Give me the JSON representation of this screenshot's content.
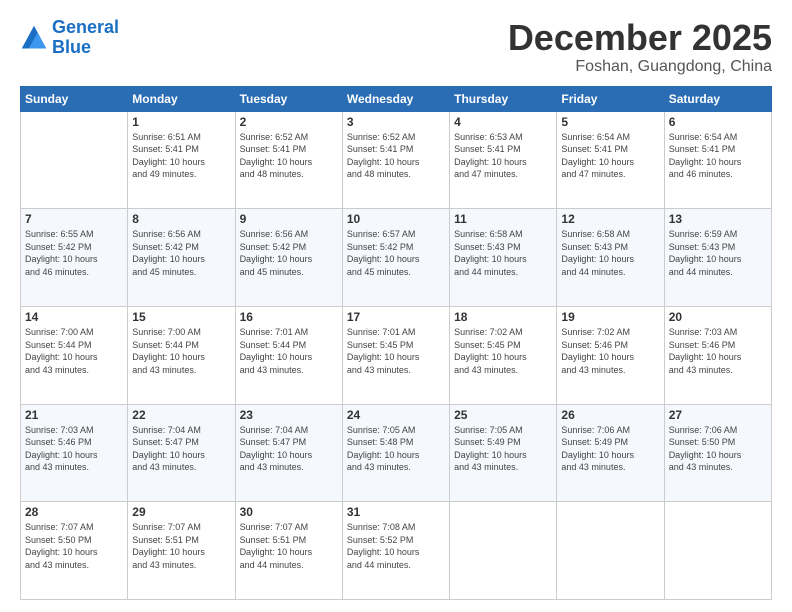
{
  "logo": {
    "line1": "General",
    "line2": "Blue"
  },
  "title": "December 2025",
  "location": "Foshan, Guangdong, China",
  "days_of_week": [
    "Sunday",
    "Monday",
    "Tuesday",
    "Wednesday",
    "Thursday",
    "Friday",
    "Saturday"
  ],
  "weeks": [
    [
      {
        "day": "",
        "info": ""
      },
      {
        "day": "1",
        "info": "Sunrise: 6:51 AM\nSunset: 5:41 PM\nDaylight: 10 hours\nand 49 minutes."
      },
      {
        "day": "2",
        "info": "Sunrise: 6:52 AM\nSunset: 5:41 PM\nDaylight: 10 hours\nand 48 minutes."
      },
      {
        "day": "3",
        "info": "Sunrise: 6:52 AM\nSunset: 5:41 PM\nDaylight: 10 hours\nand 48 minutes."
      },
      {
        "day": "4",
        "info": "Sunrise: 6:53 AM\nSunset: 5:41 PM\nDaylight: 10 hours\nand 47 minutes."
      },
      {
        "day": "5",
        "info": "Sunrise: 6:54 AM\nSunset: 5:41 PM\nDaylight: 10 hours\nand 47 minutes."
      },
      {
        "day": "6",
        "info": "Sunrise: 6:54 AM\nSunset: 5:41 PM\nDaylight: 10 hours\nand 46 minutes."
      }
    ],
    [
      {
        "day": "7",
        "info": "Sunrise: 6:55 AM\nSunset: 5:42 PM\nDaylight: 10 hours\nand 46 minutes."
      },
      {
        "day": "8",
        "info": "Sunrise: 6:56 AM\nSunset: 5:42 PM\nDaylight: 10 hours\nand 45 minutes."
      },
      {
        "day": "9",
        "info": "Sunrise: 6:56 AM\nSunset: 5:42 PM\nDaylight: 10 hours\nand 45 minutes."
      },
      {
        "day": "10",
        "info": "Sunrise: 6:57 AM\nSunset: 5:42 PM\nDaylight: 10 hours\nand 45 minutes."
      },
      {
        "day": "11",
        "info": "Sunrise: 6:58 AM\nSunset: 5:43 PM\nDaylight: 10 hours\nand 44 minutes."
      },
      {
        "day": "12",
        "info": "Sunrise: 6:58 AM\nSunset: 5:43 PM\nDaylight: 10 hours\nand 44 minutes."
      },
      {
        "day": "13",
        "info": "Sunrise: 6:59 AM\nSunset: 5:43 PM\nDaylight: 10 hours\nand 44 minutes."
      }
    ],
    [
      {
        "day": "14",
        "info": "Sunrise: 7:00 AM\nSunset: 5:44 PM\nDaylight: 10 hours\nand 43 minutes."
      },
      {
        "day": "15",
        "info": "Sunrise: 7:00 AM\nSunset: 5:44 PM\nDaylight: 10 hours\nand 43 minutes."
      },
      {
        "day": "16",
        "info": "Sunrise: 7:01 AM\nSunset: 5:44 PM\nDaylight: 10 hours\nand 43 minutes."
      },
      {
        "day": "17",
        "info": "Sunrise: 7:01 AM\nSunset: 5:45 PM\nDaylight: 10 hours\nand 43 minutes."
      },
      {
        "day": "18",
        "info": "Sunrise: 7:02 AM\nSunset: 5:45 PM\nDaylight: 10 hours\nand 43 minutes."
      },
      {
        "day": "19",
        "info": "Sunrise: 7:02 AM\nSunset: 5:46 PM\nDaylight: 10 hours\nand 43 minutes."
      },
      {
        "day": "20",
        "info": "Sunrise: 7:03 AM\nSunset: 5:46 PM\nDaylight: 10 hours\nand 43 minutes."
      }
    ],
    [
      {
        "day": "21",
        "info": "Sunrise: 7:03 AM\nSunset: 5:46 PM\nDaylight: 10 hours\nand 43 minutes."
      },
      {
        "day": "22",
        "info": "Sunrise: 7:04 AM\nSunset: 5:47 PM\nDaylight: 10 hours\nand 43 minutes."
      },
      {
        "day": "23",
        "info": "Sunrise: 7:04 AM\nSunset: 5:47 PM\nDaylight: 10 hours\nand 43 minutes."
      },
      {
        "day": "24",
        "info": "Sunrise: 7:05 AM\nSunset: 5:48 PM\nDaylight: 10 hours\nand 43 minutes."
      },
      {
        "day": "25",
        "info": "Sunrise: 7:05 AM\nSunset: 5:49 PM\nDaylight: 10 hours\nand 43 minutes."
      },
      {
        "day": "26",
        "info": "Sunrise: 7:06 AM\nSunset: 5:49 PM\nDaylight: 10 hours\nand 43 minutes."
      },
      {
        "day": "27",
        "info": "Sunrise: 7:06 AM\nSunset: 5:50 PM\nDaylight: 10 hours\nand 43 minutes."
      }
    ],
    [
      {
        "day": "28",
        "info": "Sunrise: 7:07 AM\nSunset: 5:50 PM\nDaylight: 10 hours\nand 43 minutes."
      },
      {
        "day": "29",
        "info": "Sunrise: 7:07 AM\nSunset: 5:51 PM\nDaylight: 10 hours\nand 43 minutes."
      },
      {
        "day": "30",
        "info": "Sunrise: 7:07 AM\nSunset: 5:51 PM\nDaylight: 10 hours\nand 44 minutes."
      },
      {
        "day": "31",
        "info": "Sunrise: 7:08 AM\nSunset: 5:52 PM\nDaylight: 10 hours\nand 44 minutes."
      },
      {
        "day": "",
        "info": ""
      },
      {
        "day": "",
        "info": ""
      },
      {
        "day": "",
        "info": ""
      }
    ]
  ]
}
